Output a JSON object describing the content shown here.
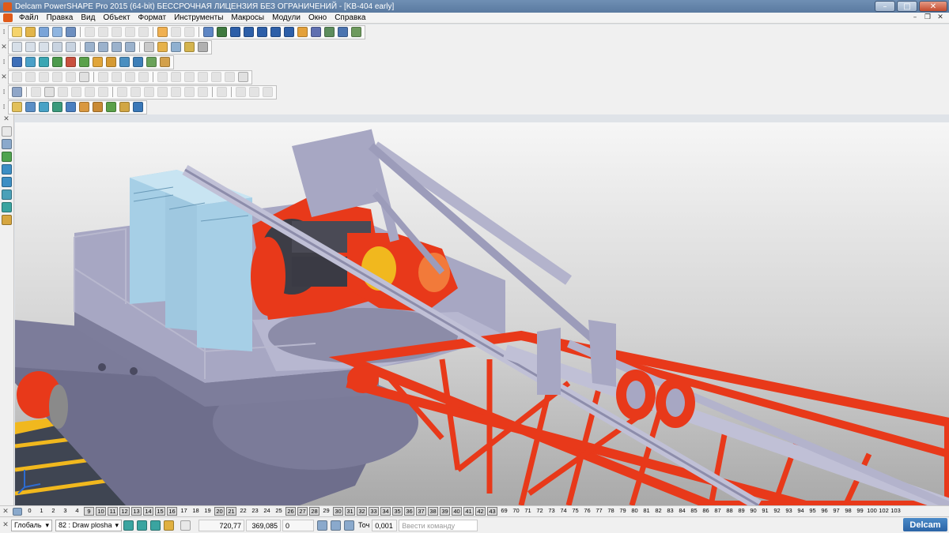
{
  "window": {
    "title": "Delcam PowerSHAPE Pro 2015 (64-bit) БЕССРОЧНАЯ ЛИЦЕНЗИЯ БЕЗ ОГРАНИЧЕНИЙ - [KB-404 early]",
    "minimize": "–",
    "maximize": "□",
    "close": "✕"
  },
  "menu": {
    "items": [
      "Файл",
      "Правка",
      "Вид",
      "Объект",
      "Формат",
      "Инструменты",
      "Макросы",
      "Модули",
      "Окно",
      "Справка"
    ],
    "mdi_minimize": "–",
    "mdi_restore": "❐",
    "mdi_close": "✕"
  },
  "toolbar_grip": "✕",
  "levels": {
    "numbers": [
      "0",
      "1",
      "2",
      "3",
      "4",
      "9",
      "10",
      "11",
      "12",
      "13",
      "14",
      "15",
      "16",
      "17",
      "18",
      "19",
      "20",
      "21",
      "22",
      "23",
      "24",
      "25",
      "26",
      "27",
      "28",
      "29",
      "30",
      "31",
      "32",
      "33",
      "34",
      "35",
      "36",
      "37",
      "38",
      "39",
      "40",
      "41",
      "42",
      "43",
      "69",
      "70",
      "71",
      "72",
      "73",
      "74",
      "75",
      "76",
      "77",
      "78",
      "79",
      "80",
      "81",
      "82",
      "83",
      "84",
      "85",
      "86",
      "87",
      "88",
      "89",
      "90",
      "91",
      "92",
      "93",
      "94",
      "95",
      "96",
      "97",
      "98",
      "99",
      "100",
      "102",
      "103"
    ],
    "active": [
      "9",
      "10",
      "11",
      "12",
      "13",
      "14",
      "15",
      "16",
      "20",
      "21",
      "26",
      "27",
      "28",
      "30",
      "31",
      "32",
      "33",
      "34",
      "35",
      "36",
      "37",
      "38",
      "39",
      "40",
      "41",
      "42",
      "43"
    ]
  },
  "status": {
    "workplane": "Глобаль",
    "level": "82 : Draw ploshad",
    "coord_x": "720,77",
    "coord_y": "369,085",
    "coord_z": "0",
    "tol_label": "Точ",
    "tolerance": "0,001",
    "command_placeholder": "Ввести команду",
    "brand": "Delcam"
  },
  "colors": {
    "steel": "#a7a7c3",
    "steel_dark": "#6e6e8c",
    "red": "#e8391a",
    "cyan": "#a6cfe6",
    "yellow": "#f1b81e"
  }
}
